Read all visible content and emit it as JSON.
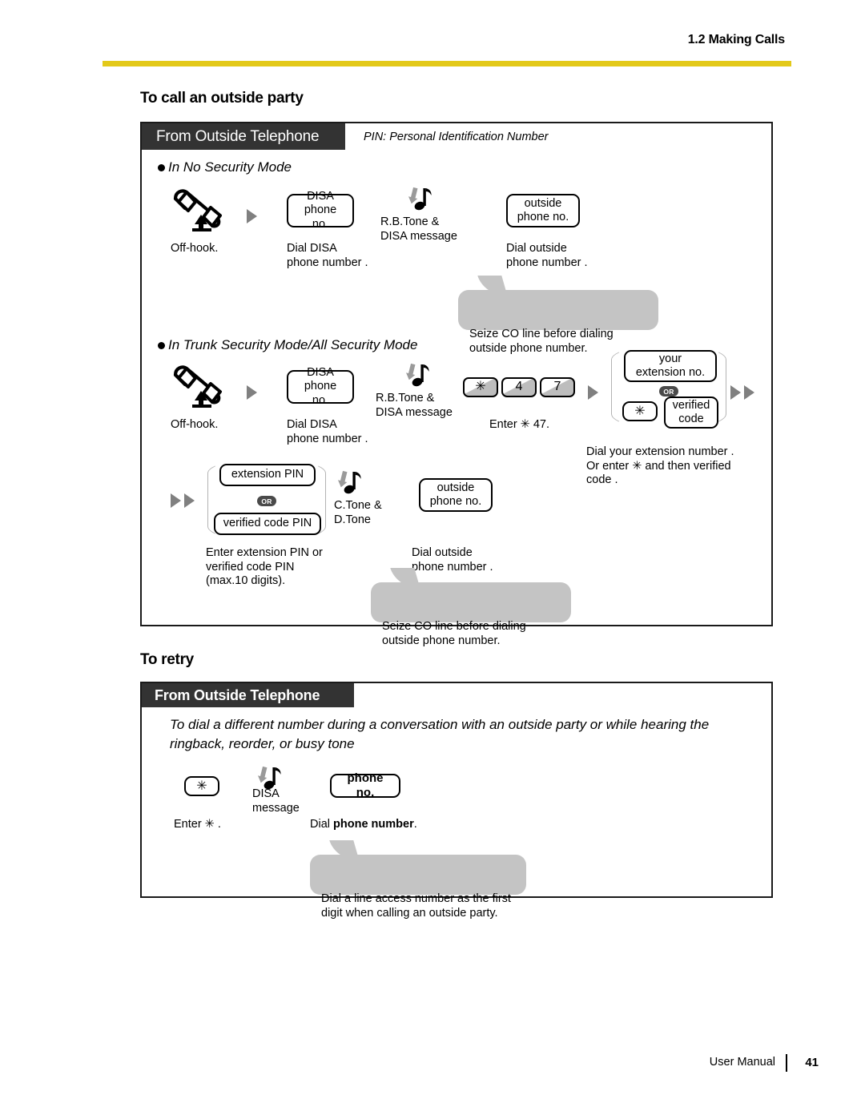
{
  "header": {
    "title": "1.2 Making Calls",
    "rule_color": "#e3c91a"
  },
  "sections": [
    {
      "heading": "To call an outside party",
      "tab_label": "From Outside Telephone",
      "pin_note": "PIN: Personal Identification Number",
      "modes": [
        {
          "title": "In No Security Mode",
          "steps": [
            {
              "icon": "off-hook-handset-icon",
              "caption": "Off-hook."
            },
            {
              "box": "DISA\nphone no.",
              "caption": "Dial DISA\nphone number  ."
            },
            {
              "icon": "tone-note-icon",
              "tone_label": "R.B.Tone &\nDISA message"
            },
            {
              "box": "outside\nphone no.",
              "caption": "Dial outside\nphone number  ."
            }
          ],
          "callout": "Seize CO line before dialing\noutside phone number."
        },
        {
          "title": "In Trunk Security Mode/All Security Mode",
          "steps": [
            {
              "icon": "off-hook-handset-icon",
              "caption": "Off-hook."
            },
            {
              "box": "DISA\nphone no.",
              "caption": "Dial DISA\nphone number  ."
            },
            {
              "icon": "tone-note-icon",
              "tone_label": "R.B.Tone &\nDISA message"
            },
            {
              "keys": [
                "✳",
                "4",
                "7"
              ],
              "caption": "Enter ✳ 47."
            },
            {
              "or_group": {
                "option_a": "your\nextension no.",
                "or_label": "OR",
                "option_b_key": "✳",
                "option_b": "verified\ncode"
              },
              "caption": "Dial your extension number   .\nOr enter  ✳ and then verified\ncode ."
            },
            {
              "or_group2": {
                "option_a": "extension PIN",
                "or_label": "OR",
                "option_b": "verified code PIN"
              },
              "caption": "Enter extension PIN  or\nverified code PIN\n(max.10 digits)."
            },
            {
              "icon": "tone-note-icon",
              "tone_label": "C.Tone &\nD.Tone"
            },
            {
              "box": "outside\nphone no.",
              "caption": "Dial outside\nphone number  ."
            }
          ],
          "callout": "Seize CO line before dialing\noutside phone number."
        }
      ]
    },
    {
      "heading": "To retry",
      "tab_label": "From Outside Telephone",
      "description": "To dial a different number during a conversation with an outside party or while hearing the ringback, reorder, or busy tone",
      "steps": [
        {
          "key": "✳",
          "caption": "Enter ✳ ."
        },
        {
          "icon": "tone-note-icon",
          "tone_label": "DISA\nmessage"
        },
        {
          "box": "phone no.",
          "caption_prefix": "Dial ",
          "caption_bold": "phone number",
          "caption_suffix": "."
        }
      ],
      "callout": "Dial a line access number as the first\ndigit when calling an outside party."
    }
  ],
  "footer": {
    "manual_label": "User Manual",
    "page_number": "41"
  }
}
